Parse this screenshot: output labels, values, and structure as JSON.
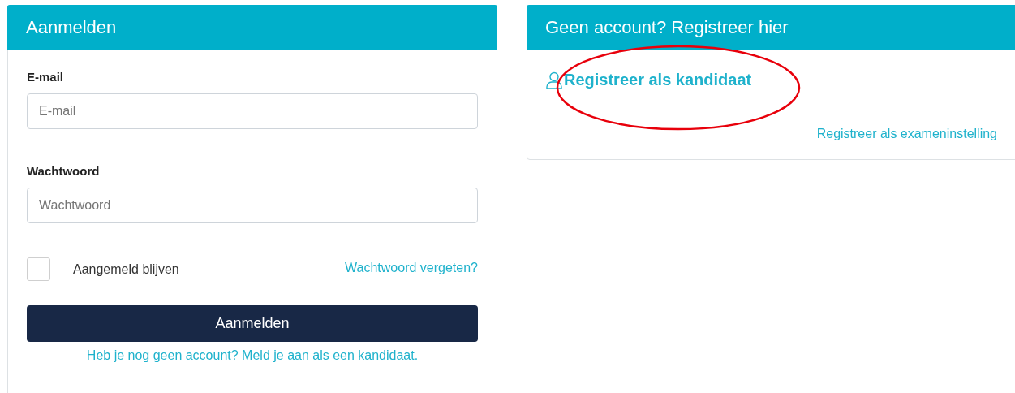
{
  "login": {
    "title": "Aanmelden",
    "fields": [
      {
        "label": "E-mail",
        "placeholder": "E-mail"
      },
      {
        "label": "Wachtwoord",
        "placeholder": "Wachtwoord"
      }
    ],
    "remember": {
      "label": "Aangemeld blijven",
      "checked": false
    },
    "forgot_link": "Wachtwoord vergeten?",
    "submit": "Aanmelden",
    "signup_link": "Heb je nog geen account? Meld je aan als een kandidaat."
  },
  "register": {
    "title": "Geen account? Registreer hier",
    "candidate_link": "Registreer als kandidaat",
    "institution_link": "Registreer als exameninstelling"
  },
  "annotations": [
    {
      "kind": "ellipse"
    }
  ]
}
